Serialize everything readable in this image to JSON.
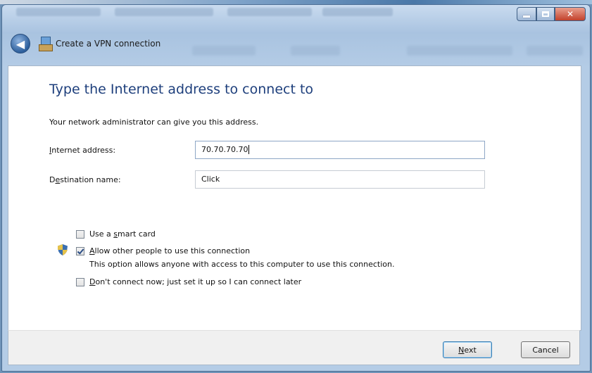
{
  "window": {
    "title": "Create a VPN connection"
  },
  "page": {
    "heading": "Type the Internet address to connect to",
    "subtitle": "Your network administrator can give you this address."
  },
  "form": {
    "internet_address": {
      "label_prefix": "",
      "label_key": "I",
      "label_rest": "nternet address:",
      "value": "70.70.70.70"
    },
    "destination_name": {
      "label_prefix": "D",
      "label_key": "e",
      "label_rest": "stination name:",
      "value": "Click"
    }
  },
  "options": {
    "smart_card": {
      "pre": "Use a ",
      "key": "s",
      "post": "mart card",
      "checked": false
    },
    "allow_others": {
      "pre": "",
      "key": "A",
      "post": "llow other people to use this connection",
      "checked": true,
      "description": "This option allows anyone with access to this computer to use this connection."
    },
    "dont_connect": {
      "pre": "",
      "key": "D",
      "post": "on't connect now; just set it up so I can connect later",
      "checked": false
    }
  },
  "buttons": {
    "next_key": "N",
    "next_rest": "ext",
    "cancel": "Cancel"
  },
  "icons": {
    "back": "back-arrow-icon",
    "vpn": "vpn-connection-icon",
    "shield": "uac-shield-icon"
  },
  "colors": {
    "heading": "#1e3f7c",
    "chrome": "#a9c3e0",
    "close_button": "#c2412b"
  }
}
